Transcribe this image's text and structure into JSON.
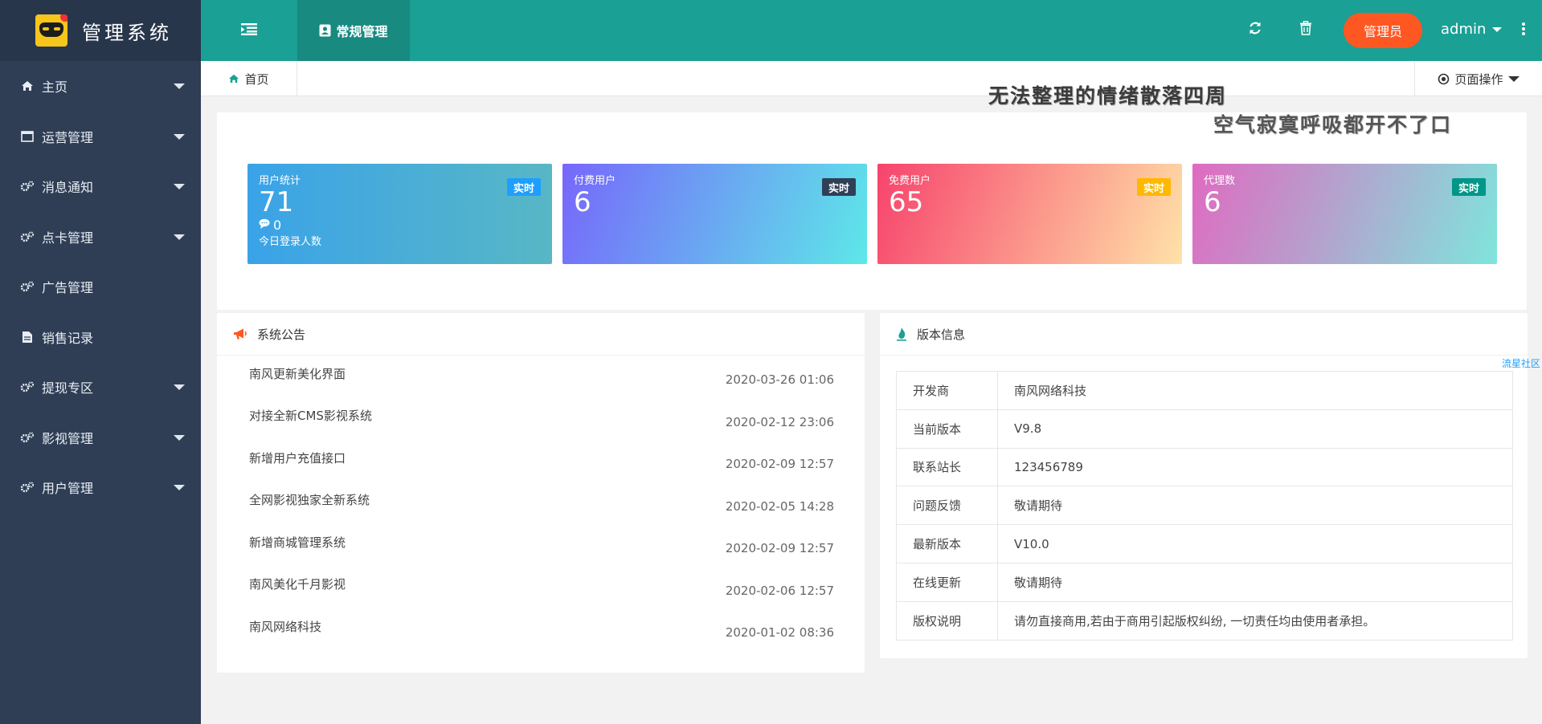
{
  "app": {
    "title": "管理系统"
  },
  "sidebar": {
    "items": [
      {
        "label": "主页",
        "icon": "home-icon",
        "has_caret": true
      },
      {
        "label": "运营管理",
        "icon": "window-icon",
        "has_caret": true
      },
      {
        "label": "消息通知",
        "icon": "cogs-icon",
        "has_caret": true
      },
      {
        "label": "点卡管理",
        "icon": "cogs-icon",
        "has_caret": true
      },
      {
        "label": "广告管理",
        "icon": "cogs-icon",
        "has_caret": false
      },
      {
        "label": "销售记录",
        "icon": "file-icon",
        "has_caret": false
      },
      {
        "label": "提现专区",
        "icon": "cogs-icon",
        "has_caret": true
      },
      {
        "label": "影视管理",
        "icon": "cogs-icon",
        "has_caret": true
      },
      {
        "label": "用户管理",
        "icon": "cogs-icon",
        "has_caret": true
      }
    ]
  },
  "header": {
    "active_tab": "常规管理",
    "role_button": "管理员",
    "username": "admin"
  },
  "tabbar": {
    "home": "首页",
    "page_ops": "页面操作"
  },
  "decor": {
    "line1": "无法整理的情绪散落四周",
    "line2": "空气寂寞呼吸都开不了口"
  },
  "stats": [
    {
      "label": "用户统计",
      "value": "71",
      "badge": "实时",
      "sub_value": "0",
      "sub_label": "今日登录人数"
    },
    {
      "label": "付费用户",
      "value": "6",
      "badge": "实时"
    },
    {
      "label": "免费用户",
      "value": "65",
      "badge": "实时"
    },
    {
      "label": "代理数",
      "value": "6",
      "badge": "实时"
    }
  ],
  "notice": {
    "title": "系统公告",
    "items": [
      {
        "title": "南风更新美化界面",
        "date": "2020-03-26 01:06"
      },
      {
        "title": "对接全新CMS影视系统",
        "date": "2020-02-12 23:06"
      },
      {
        "title": "新增用户充值接口",
        "date": "2020-02-09 12:57"
      },
      {
        "title": "全网影视独家全新系统",
        "date": "2020-02-05 14:28"
      },
      {
        "title": "新增商城管理系统",
        "date": "2020-02-09 12:57"
      },
      {
        "title": "南风美化千月影视",
        "date": "2020-02-06 12:57"
      },
      {
        "title": "南风网络科技",
        "date": "2020-01-02 08:36"
      }
    ]
  },
  "version": {
    "title": "版本信息",
    "side_link": "流星社区",
    "rows": [
      {
        "key": "开发商",
        "value": "南风网络科技"
      },
      {
        "key": "当前版本",
        "value": "V9.8"
      },
      {
        "key": "联系站长",
        "value": "123456789"
      },
      {
        "key": "问题反馈",
        "value": "敬请期待"
      },
      {
        "key": "最新版本",
        "value": "V10.0"
      },
      {
        "key": "在线更新",
        "value": "敬请期待"
      },
      {
        "key": "版权说明",
        "value": "请勿直接商用,若由于商用引起版权纠纷, 一切责任均由使用者承担。"
      }
    ]
  },
  "colors": {
    "header": "#1aa094",
    "sidebar": "#2f3e55",
    "role_button": "#ff5722"
  }
}
